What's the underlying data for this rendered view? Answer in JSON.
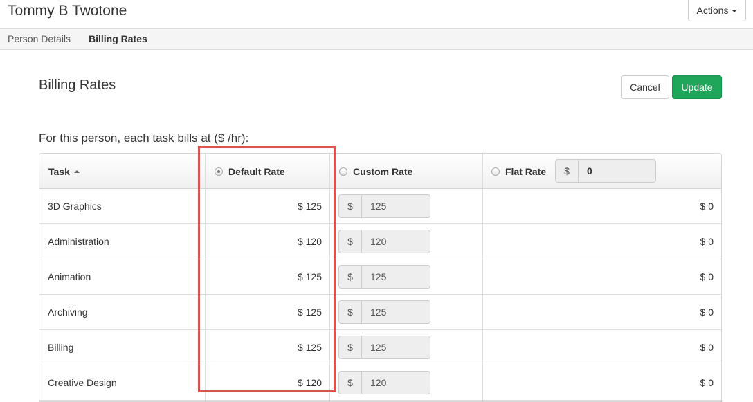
{
  "header": {
    "person_name": "Tommy B Twotone",
    "actions_label": "Actions"
  },
  "tabs": [
    {
      "label": "Person Details",
      "active": false
    },
    {
      "label": "Billing Rates",
      "active": true
    }
  ],
  "section": {
    "title": "Billing Rates",
    "cancel_label": "Cancel",
    "update_label": "Update",
    "intro": "For this person, each task bills at ($ /hr):"
  },
  "table": {
    "columns": {
      "task": "Task",
      "default_rate": "Default Rate",
      "custom_rate": "Custom Rate",
      "flat_rate": "Flat Rate"
    },
    "selected_rate_option": "Default Rate",
    "flat_rate_input": {
      "prefix": "$",
      "value": "0"
    },
    "currency_prefix": "$",
    "rows": [
      {
        "task": "3D Graphics",
        "default": "$ 125",
        "custom": "125",
        "flat": "$ 0"
      },
      {
        "task": "Administration",
        "default": "$ 120",
        "custom": "120",
        "flat": "$ 0"
      },
      {
        "task": "Animation",
        "default": "$ 125",
        "custom": "125",
        "flat": "$ 0"
      },
      {
        "task": "Archiving",
        "default": "$ 125",
        "custom": "125",
        "flat": "$ 0"
      },
      {
        "task": "Billing",
        "default": "$ 125",
        "custom": "125",
        "flat": "$ 0"
      },
      {
        "task": "Creative Design",
        "default": "$ 120",
        "custom": "120",
        "flat": "$ 0"
      }
    ]
  },
  "colors": {
    "update_button": "#1fa65a",
    "highlight_border": "#d9534f"
  }
}
